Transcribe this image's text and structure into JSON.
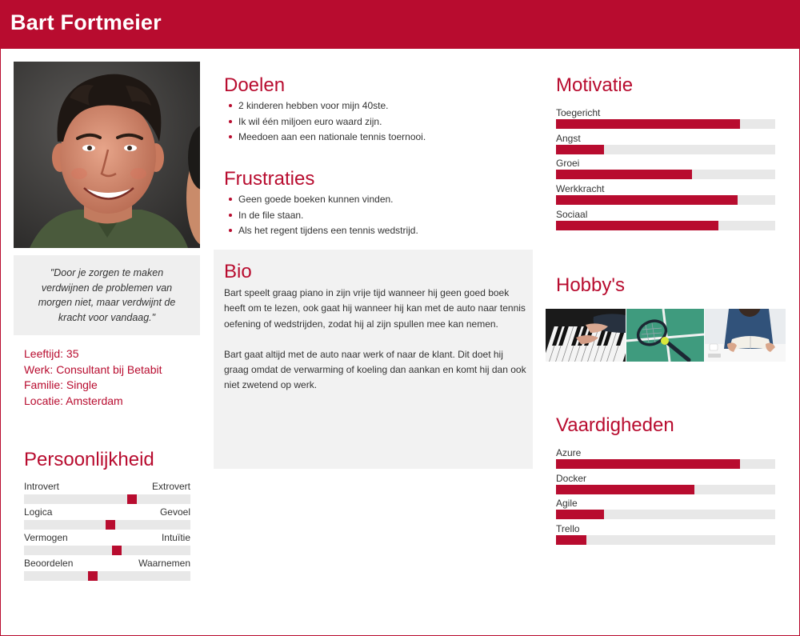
{
  "header": {
    "name": "Bart Fortmeier"
  },
  "quote": "\"Door je zorgen te maken verdwijnen de problemen van morgen niet, maar verdwijnt de kracht voor vandaag.\"",
  "info": {
    "age": "Leeftijd: 35",
    "work": "Werk: Consultant bij Betabit",
    "family": "Familie: Single",
    "location": "Locatie: Amsterdam"
  },
  "personality": {
    "title": "Persoonlijkheid",
    "scales": [
      {
        "left": "Introvert",
        "right": "Extrovert",
        "position": 0.66
      },
      {
        "left": "Logica",
        "right": "Gevoel",
        "position": 0.52
      },
      {
        "left": "Vermogen",
        "right": "Intuïtie",
        "position": 0.56
      },
      {
        "left": "Beoordelen",
        "right": "Waarnemen",
        "position": 0.41
      }
    ]
  },
  "goals": {
    "title": "Doelen",
    "items": [
      "2 kinderen hebben voor mijn 40ste.",
      "Ik wil één miljoen euro waard zijn.",
      "Meedoen aan een nationale tennis toernooi."
    ]
  },
  "frustrations": {
    "title": "Frustraties",
    "items": [
      "Geen goede boeken kunnen vinden.",
      "In de file staan.",
      "Als het regent tijdens een tennis wedstrijd."
    ]
  },
  "bio": {
    "title": "Bio",
    "paragraphs": [
      "Bart speelt graag piano in zijn vrije tijd wanneer hij geen goed boek heeft om te lezen, ook gaat hij wanneer hij kan met de auto naar tennis oefening of wedstrijden, zodat hij al zijn spullen mee kan nemen.",
      "Bart gaat altijd met de auto naar werk of naar de klant. Dit doet hij graag omdat de verwarming of koeling dan aankan en komt hij dan ook niet zwetend op werk."
    ]
  },
  "motivation": {
    "title": "Motivatie",
    "items": [
      {
        "label": "Toegericht",
        "value": 0.84
      },
      {
        "label": "Angst",
        "value": 0.22
      },
      {
        "label": "Groei",
        "value": 0.62
      },
      {
        "label": "Werkkracht",
        "value": 0.83
      },
      {
        "label": "Sociaal",
        "value": 0.74
      }
    ]
  },
  "hobbies": {
    "title": "Hobby's",
    "items": [
      "piano",
      "tennis",
      "lezen"
    ]
  },
  "skills": {
    "title": "Vaardigheden",
    "items": [
      {
        "label": "Azure",
        "value": 0.84
      },
      {
        "label": "Docker",
        "value": 0.63
      },
      {
        "label": "Agile",
        "value": 0.22
      },
      {
        "label": "Trello",
        "value": 0.14
      }
    ]
  },
  "colors": {
    "accent": "#b80c2f",
    "track": "#e8e8e8",
    "panel": "#efefef"
  }
}
